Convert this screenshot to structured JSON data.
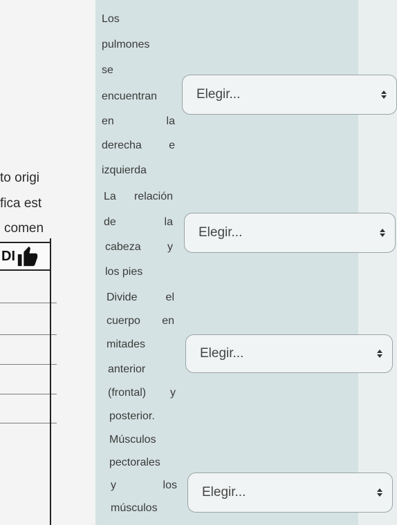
{
  "left_page": {
    "lines": [
      "to origi",
      "fica est",
      "comen"
    ],
    "like_text": "DI"
  },
  "questions": [
    {
      "lines": [
        [
          "Los"
        ],
        [
          "pulmones"
        ],
        [
          "se"
        ],
        [
          "encuentran"
        ],
        [
          "en",
          "la"
        ],
        [
          "derecha",
          "e"
        ],
        [
          "izquierda"
        ]
      ],
      "select_value": "Elegir..."
    },
    {
      "lines": [
        [
          "La",
          "relación"
        ],
        [
          "de",
          "la"
        ],
        [
          "cabeza",
          "y"
        ],
        [
          "los pies"
        ]
      ],
      "select_value": "Elegir..."
    },
    {
      "lines": [
        [
          "Divide",
          "el"
        ],
        [
          "cuerpo",
          "en"
        ],
        [
          "mitades"
        ],
        [
          "anterior"
        ],
        [
          "(frontal)",
          "y"
        ],
        [
          "posterior."
        ]
      ],
      "select_value": "Elegir..."
    },
    {
      "lines": [
        [
          "Músculos"
        ],
        [
          "pectorales"
        ],
        [
          "y",
          "los"
        ],
        [
          "músculos"
        ]
      ],
      "select_value": "Elegir..."
    }
  ]
}
